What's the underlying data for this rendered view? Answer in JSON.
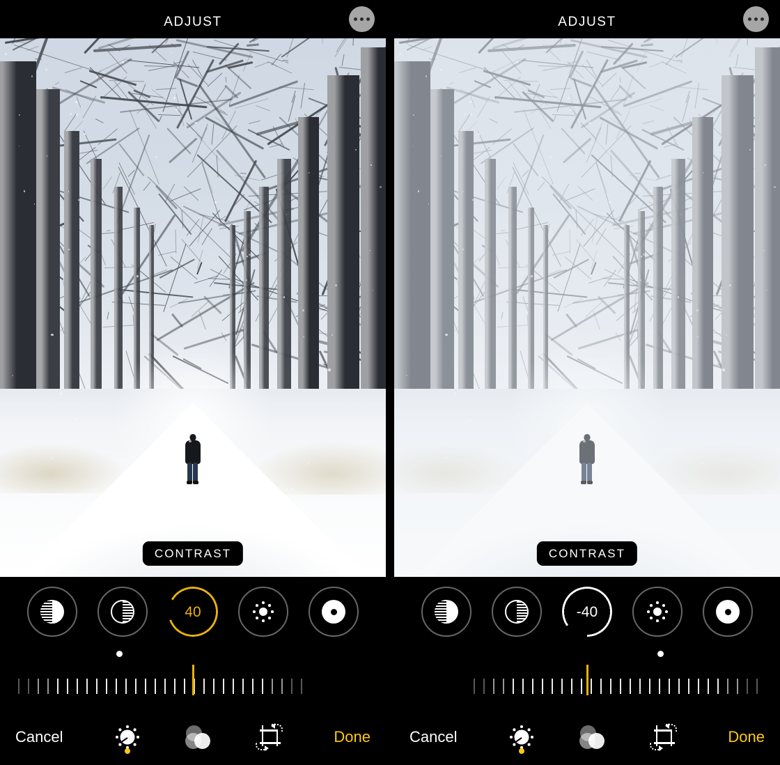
{
  "panels": [
    {
      "header": {
        "title": "ADJUST",
        "menu_icon": "ellipsis-icon"
      },
      "photo": {
        "caption": "CONTRAST",
        "scene": "person walking on snowy tree-lined road",
        "variant": "high-contrast"
      },
      "adjust": {
        "tools": [
          {
            "name": "auto-enhance",
            "icon": "contrast-filled-icon"
          },
          {
            "name": "brilliance",
            "icon": "contrast-outline-icon"
          },
          {
            "name": "contrast",
            "icon": "value-ring",
            "value": "40",
            "selected": true
          },
          {
            "name": "brightness",
            "icon": "brightness-icon"
          },
          {
            "name": "highlights",
            "icon": "donut-icon"
          }
        ],
        "value": "40",
        "ring_color": "#E8B10C",
        "indicator_color": "#E8B10C",
        "marker_tool_index": 1
      },
      "toolbar": {
        "cancel_label": "Cancel",
        "done_label": "Done",
        "done_color": "#FFC90B",
        "modes": [
          {
            "name": "adjust",
            "icon": "dial-icon",
            "active": true
          },
          {
            "name": "filters",
            "icon": "filters-icon",
            "active": false
          },
          {
            "name": "crop",
            "icon": "crop-rotate-icon",
            "active": false
          }
        ]
      }
    },
    {
      "header": {
        "title": "ADJUST",
        "menu_icon": "ellipsis-icon"
      },
      "photo": {
        "caption": "CONTRAST",
        "scene": "person walking on snowy tree-lined road",
        "variant": "low-contrast"
      },
      "adjust": {
        "tools": [
          {
            "name": "auto-enhance",
            "icon": "contrast-filled-icon"
          },
          {
            "name": "brilliance",
            "icon": "contrast-outline-icon"
          },
          {
            "name": "contrast",
            "icon": "value-ring",
            "value": "-40",
            "selected": true
          },
          {
            "name": "brightness",
            "icon": "brightness-icon"
          },
          {
            "name": "highlights",
            "icon": "donut-icon"
          }
        ],
        "value": "-40",
        "ring_color": "#FFFFFF",
        "indicator_color": "#E8B10C",
        "marker_tool_index": 3
      },
      "toolbar": {
        "cancel_label": "Cancel",
        "done_label": "Done",
        "done_color": "#FFC90B",
        "modes": [
          {
            "name": "adjust",
            "icon": "dial-icon",
            "active": true
          },
          {
            "name": "filters",
            "icon": "filters-icon",
            "active": false
          },
          {
            "name": "crop",
            "icon": "crop-rotate-icon",
            "active": false
          }
        ]
      }
    }
  ]
}
